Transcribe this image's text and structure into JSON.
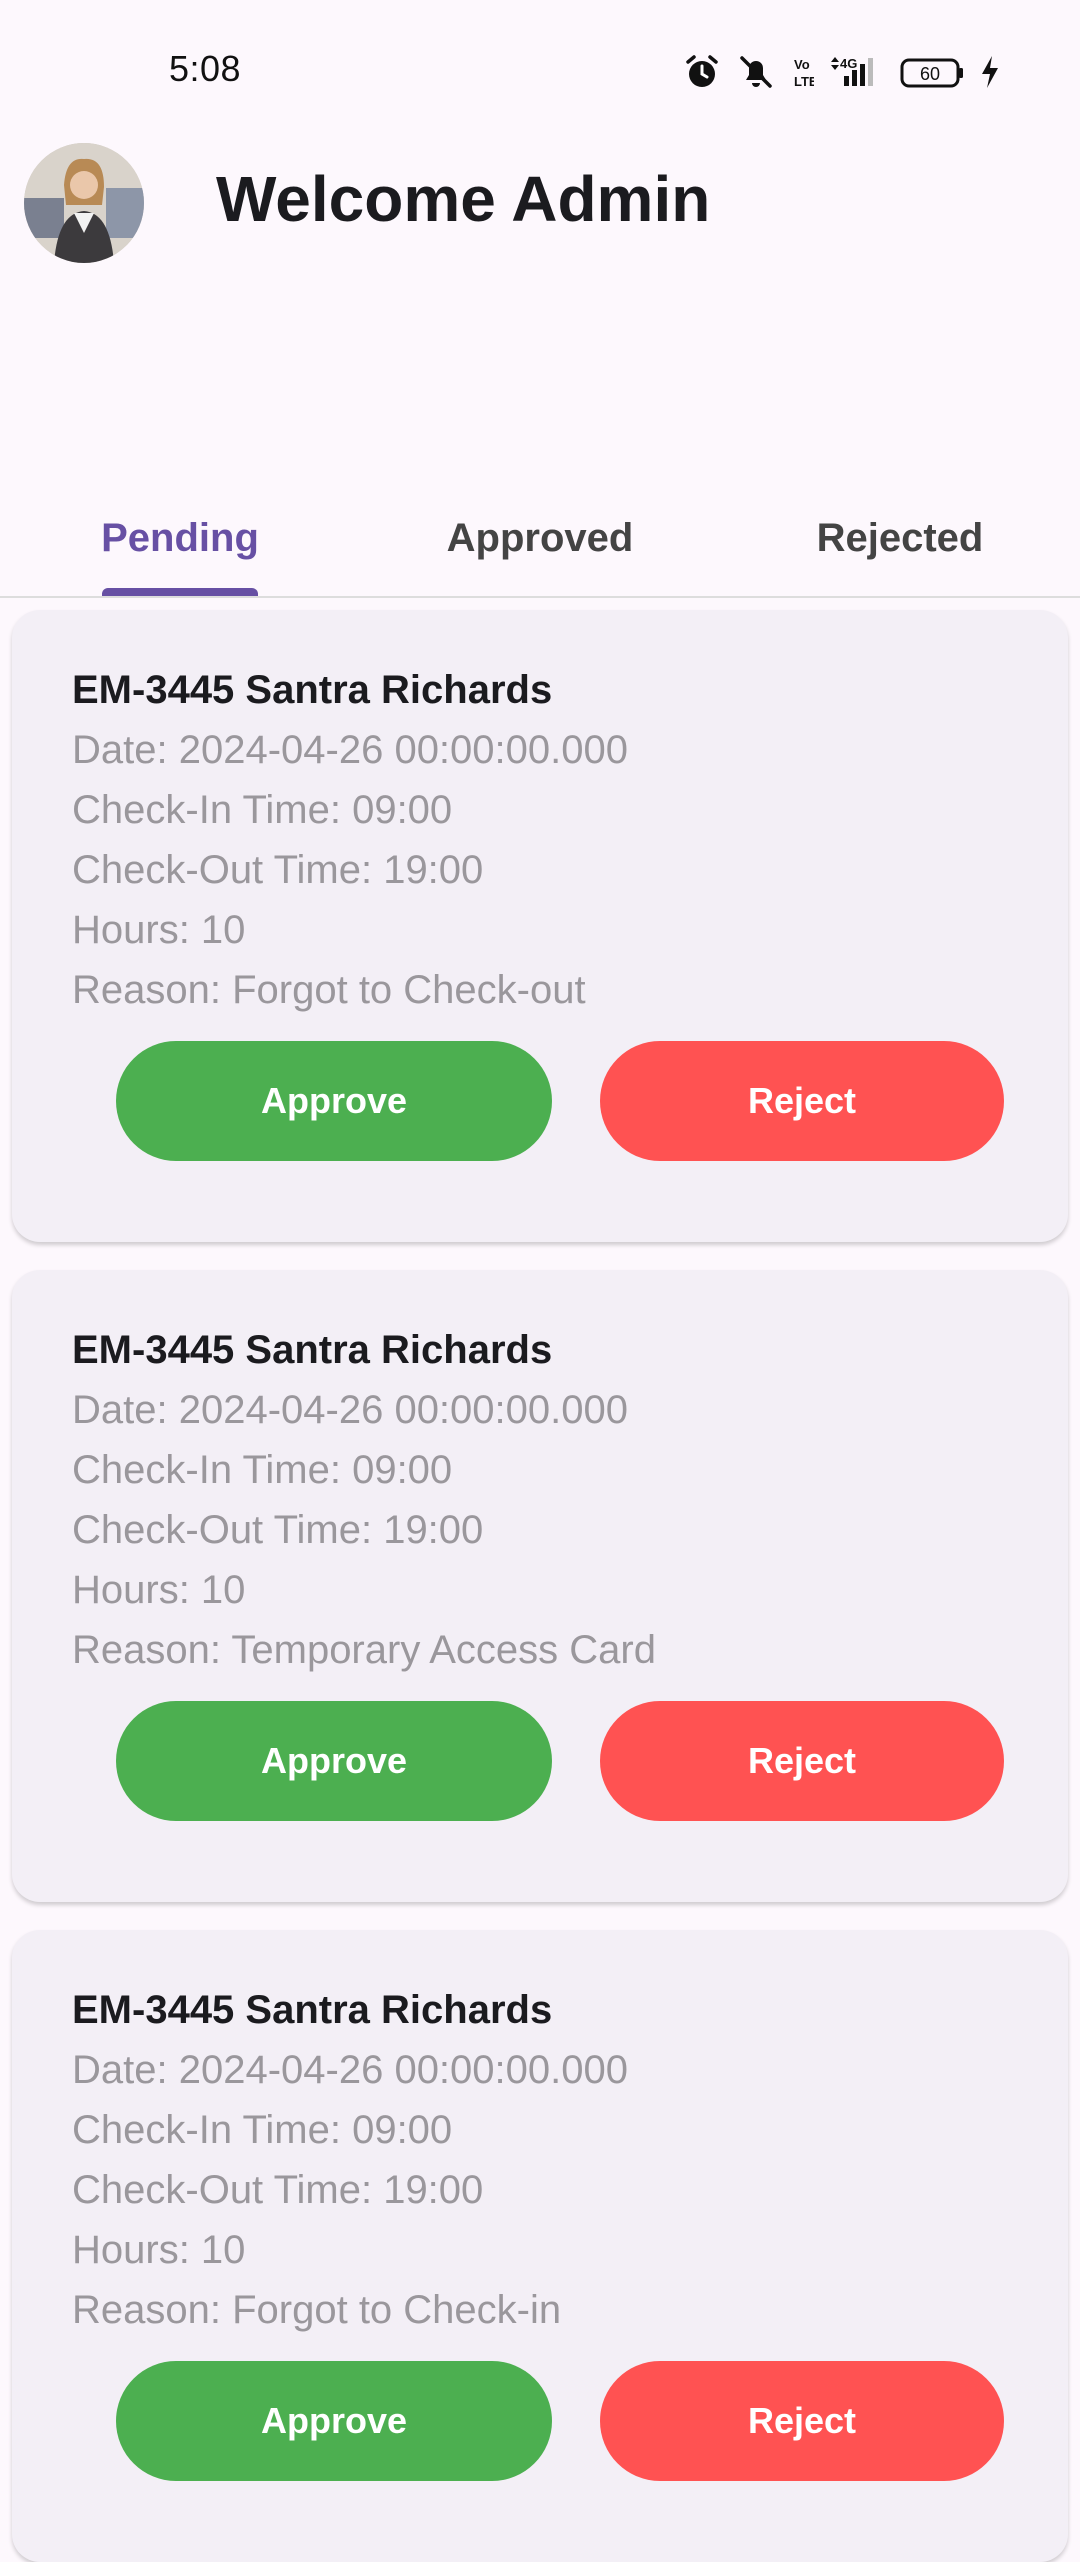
{
  "status_bar": {
    "time": "5:08",
    "battery": "60",
    "network": "4G"
  },
  "header": {
    "title": "Welcome Admin"
  },
  "tabs": [
    {
      "label": "Pending",
      "active": true
    },
    {
      "label": "Approved",
      "active": false
    },
    {
      "label": "Rejected",
      "active": false
    }
  ],
  "requests": [
    {
      "title": "EM-3445 Santra Richards",
      "date": "Date: 2024-04-26 00:00:00.000",
      "check_in": "Check-In Time: 09:00",
      "check_out": "Check-Out Time: 19:00",
      "hours": "Hours: 10",
      "reason": "Reason: Forgot to Check-out",
      "approve_label": "Approve",
      "reject_label": "Reject"
    },
    {
      "title": "EM-3445 Santra Richards",
      "date": "Date: 2024-04-26 00:00:00.000",
      "check_in": "Check-In Time: 09:00",
      "check_out": "Check-Out Time: 19:00",
      "hours": "Hours: 10",
      "reason": "Reason: Temporary Access Card",
      "approve_label": "Approve",
      "reject_label": "Reject"
    },
    {
      "title": "EM-3445 Santra Richards",
      "date": "Date: 2024-04-26 00:00:00.000",
      "check_in": "Check-In Time: 09:00",
      "check_out": "Check-Out Time: 19:00",
      "hours": "Hours: 10",
      "reason": "Reason: Forgot to Check-in",
      "approve_label": "Approve",
      "reject_label": "Reject"
    }
  ],
  "colors": {
    "accent": "#6750a4",
    "approve": "#4caf50",
    "reject": "#ff5252"
  }
}
